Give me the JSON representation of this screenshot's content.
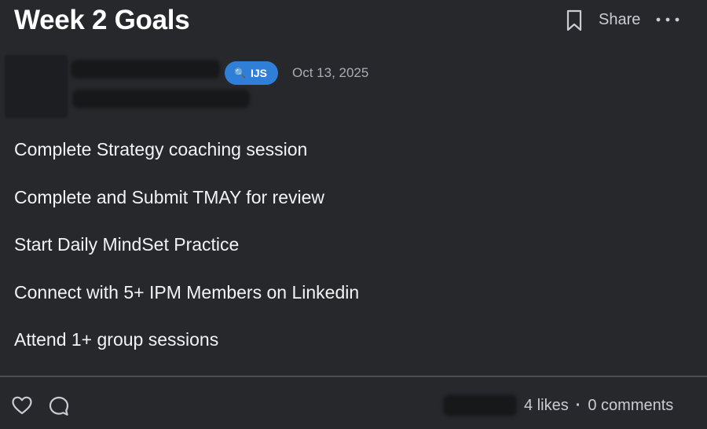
{
  "post": {
    "title": "Week 2 Goals",
    "badge_label": "IJS",
    "badge_icon": "magnifier-icon",
    "date": "Oct 13, 2025",
    "goals": [
      "Complete Strategy coaching session",
      "Complete and Submit TMAY for review",
      "Start Daily MindSet Practice",
      "Connect with 5+ IPM Members on Linkedin",
      "Attend 1+ group sessions"
    ]
  },
  "header": {
    "share_label": "Share"
  },
  "footer": {
    "likes_text": "4 likes",
    "separator": "·",
    "comments_text": "0 comments"
  },
  "colors": {
    "background": "#26282c",
    "badge": "#2f7fd8",
    "text_primary": "#f2f3f5",
    "text_secondary": "#a9adb3"
  }
}
